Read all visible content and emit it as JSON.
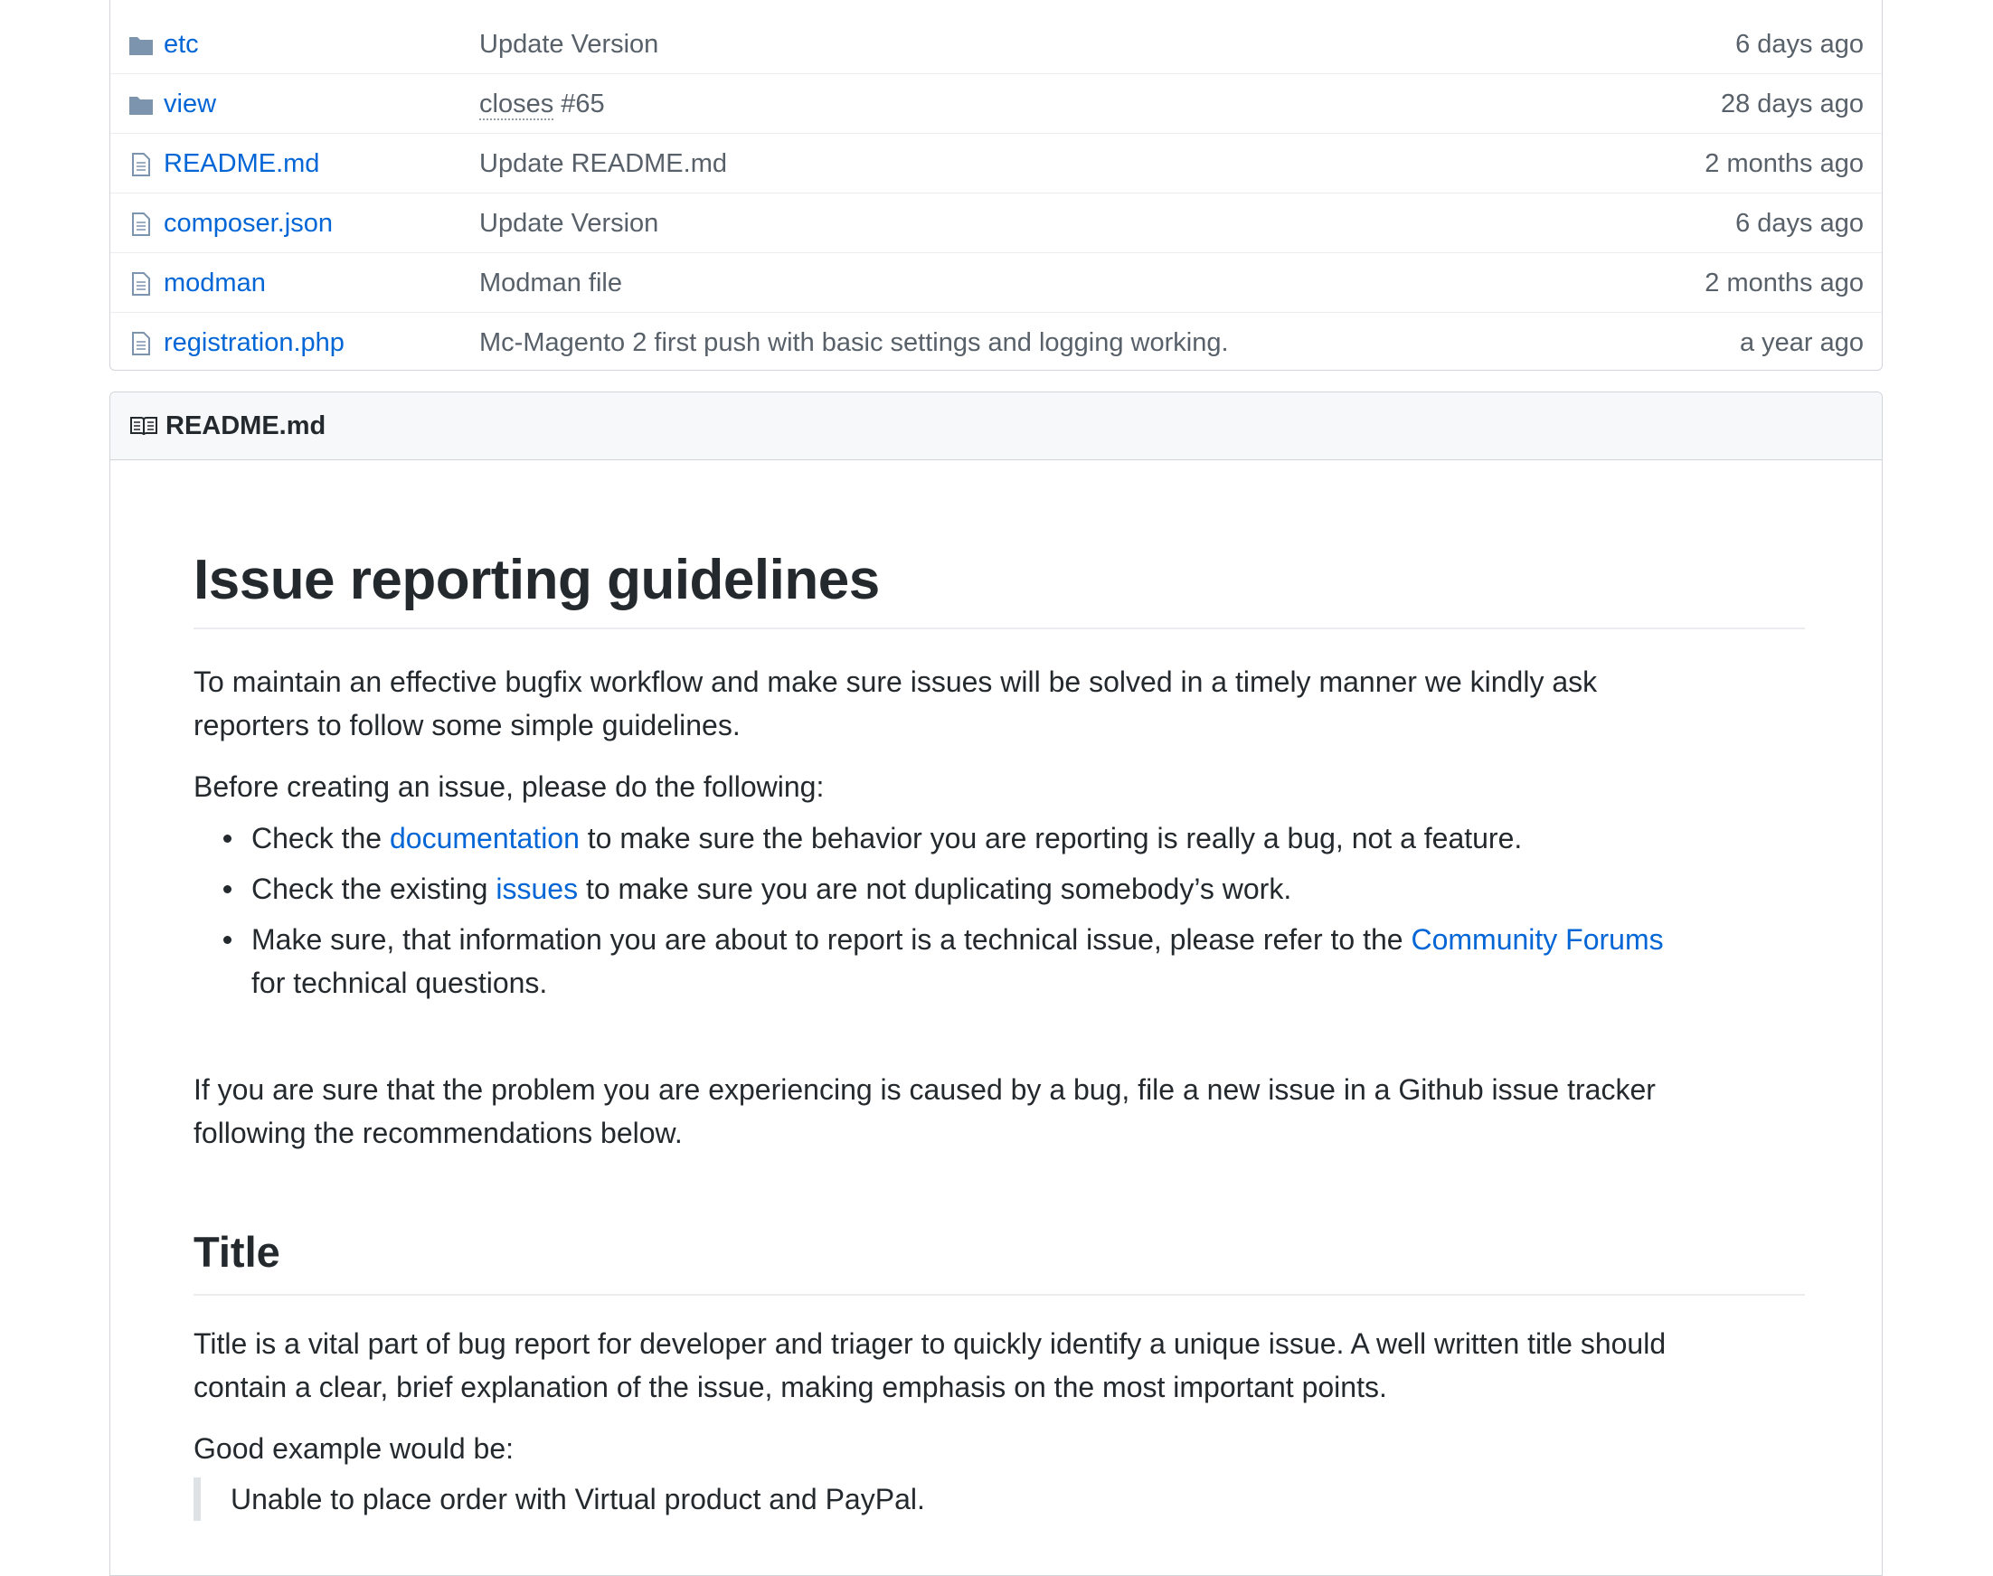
{
  "files": [
    {
      "type": "folder",
      "name": "etc",
      "message": "Update Version",
      "message_link": "",
      "message_rest": "",
      "age": "6 days ago"
    },
    {
      "type": "folder",
      "name": "view",
      "message": "",
      "message_link": "closes",
      "message_rest": " #65",
      "age": "28 days ago"
    },
    {
      "type": "file",
      "name": "README.md",
      "message": "Update README.md",
      "message_link": "",
      "message_rest": "",
      "age": "2 months ago"
    },
    {
      "type": "file",
      "name": "composer.json",
      "message": "Update Version",
      "message_link": "",
      "message_rest": "",
      "age": "6 days ago"
    },
    {
      "type": "file",
      "name": "modman",
      "message": "Modman file",
      "message_link": "",
      "message_rest": "",
      "age": "2 months ago"
    },
    {
      "type": "file",
      "name": "registration.php",
      "message": "Mc-Magento 2 first push with basic settings and logging working.",
      "message_link": "",
      "message_rest": "",
      "age": "a year ago"
    }
  ],
  "readme": {
    "header_title": "README.md",
    "h1": "Issue reporting guidelines",
    "intro_line1": "To maintain an effective bugfix workflow and make sure issues will be solved in a timely manner we kindly ask",
    "intro_line2": "reporters to follow some simple guidelines.",
    "before": "Before creating an issue, please do the following:",
    "bullets": [
      {
        "pre": "Check the ",
        "link": "documentation",
        "post": " to make sure the behavior you are reporting is really a bug, not a feature."
      },
      {
        "pre": "Check the existing ",
        "link": "issues",
        "post": " to make sure you are not duplicating somebody’s work."
      },
      {
        "pre": "Make sure, that information you are about to report is a technical issue, please refer to the ",
        "link": "Community Forums",
        "post": "",
        "line2": "for technical questions."
      }
    ],
    "sure_line1": "If you are sure that the problem you are experiencing is caused by a bug, file a new issue in a Github issue tracker",
    "sure_line2": "following the recommendations below.",
    "h2": "Title",
    "title_line1": "Title is a vital part of bug report for developer and triager to quickly identify a unique issue. A well written title should",
    "title_line2": "contain a clear, brief explanation of the issue, making emphasis on the most important points.",
    "good_example": "Good example would be:",
    "quote": "Unable to place order with Virtual product and PayPal."
  },
  "colors": {
    "link": "#0366d6",
    "muted": "#586069",
    "text": "#24292e",
    "icon": "#6a737d"
  },
  "icons": {
    "folder": "folder-icon",
    "file": "file-icon",
    "readme": "book-icon"
  }
}
